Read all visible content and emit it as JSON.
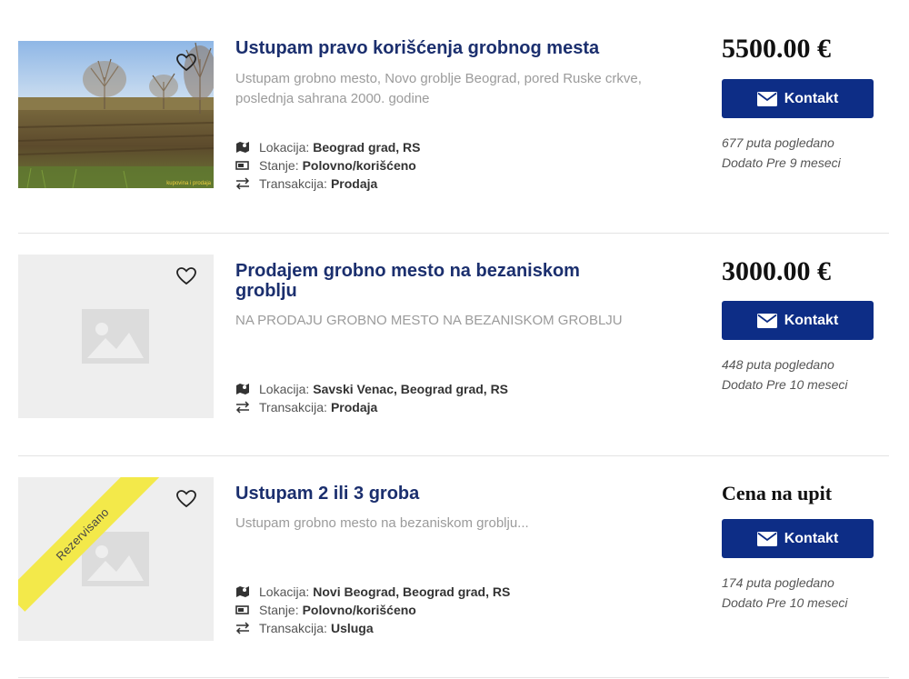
{
  "listings": [
    {
      "title": "Ustupam pravo korišćenja grobnog mesta",
      "description": "Ustupam grobno mesto, Novo groblje Beograd, pored Ruske crkve, poslednja sahrana 2000. godine",
      "image_watermark": "kupovina i prodaja",
      "attributes": [
        {
          "icon": "map-icon",
          "label": "Lokacija:",
          "value": "Beograd grad, RS"
        },
        {
          "icon": "battery-icon",
          "label": "Stanje:",
          "value": "Polovno/korišćeno"
        },
        {
          "icon": "transaction-icon",
          "label": "Transakcija:",
          "value": "Prodaja"
        }
      ],
      "price": "5500.00 €",
      "contact_label": "Kontakt",
      "views": "677 puta pogledano",
      "added": "Dodato Pre 9 meseci"
    },
    {
      "title": "Prodajem grobno mesto na bezaniskom groblju",
      "description": "NA PRODAJU GROBNO MESTO NA BEZANISKOM GROBLJU",
      "attributes": [
        {
          "icon": "map-icon",
          "label": "Lokacija:",
          "value": "Savski Venac, Beograd grad, RS"
        },
        {
          "icon": "transaction-icon",
          "label": "Transakcija:",
          "value": "Prodaja"
        }
      ],
      "price": "3000.00 €",
      "contact_label": "Kontakt",
      "views": "448 puta pogledano",
      "added": "Dodato Pre 10 meseci"
    },
    {
      "title": "Ustupam 2 ili 3 groba",
      "description": "Ustupam grobno mesto na bezaniskom groblju...",
      "ribbon": "Rezervisano",
      "attributes": [
        {
          "icon": "map-icon",
          "label": "Lokacija:",
          "value": "Novi Beograd, Beograd grad, RS"
        },
        {
          "icon": "battery-icon",
          "label": "Stanje:",
          "value": "Polovno/korišćeno"
        },
        {
          "icon": "transaction-icon",
          "label": "Transakcija:",
          "value": "Usluga"
        }
      ],
      "price": "Cena na upit",
      "contact_label": "Kontakt",
      "views": "174 puta pogledano",
      "added": "Dodato Pre 10 meseci"
    }
  ],
  "colors": {
    "title": "#1b2f6e",
    "button": "#0d2d86",
    "ribbon": "#f3e94a"
  }
}
